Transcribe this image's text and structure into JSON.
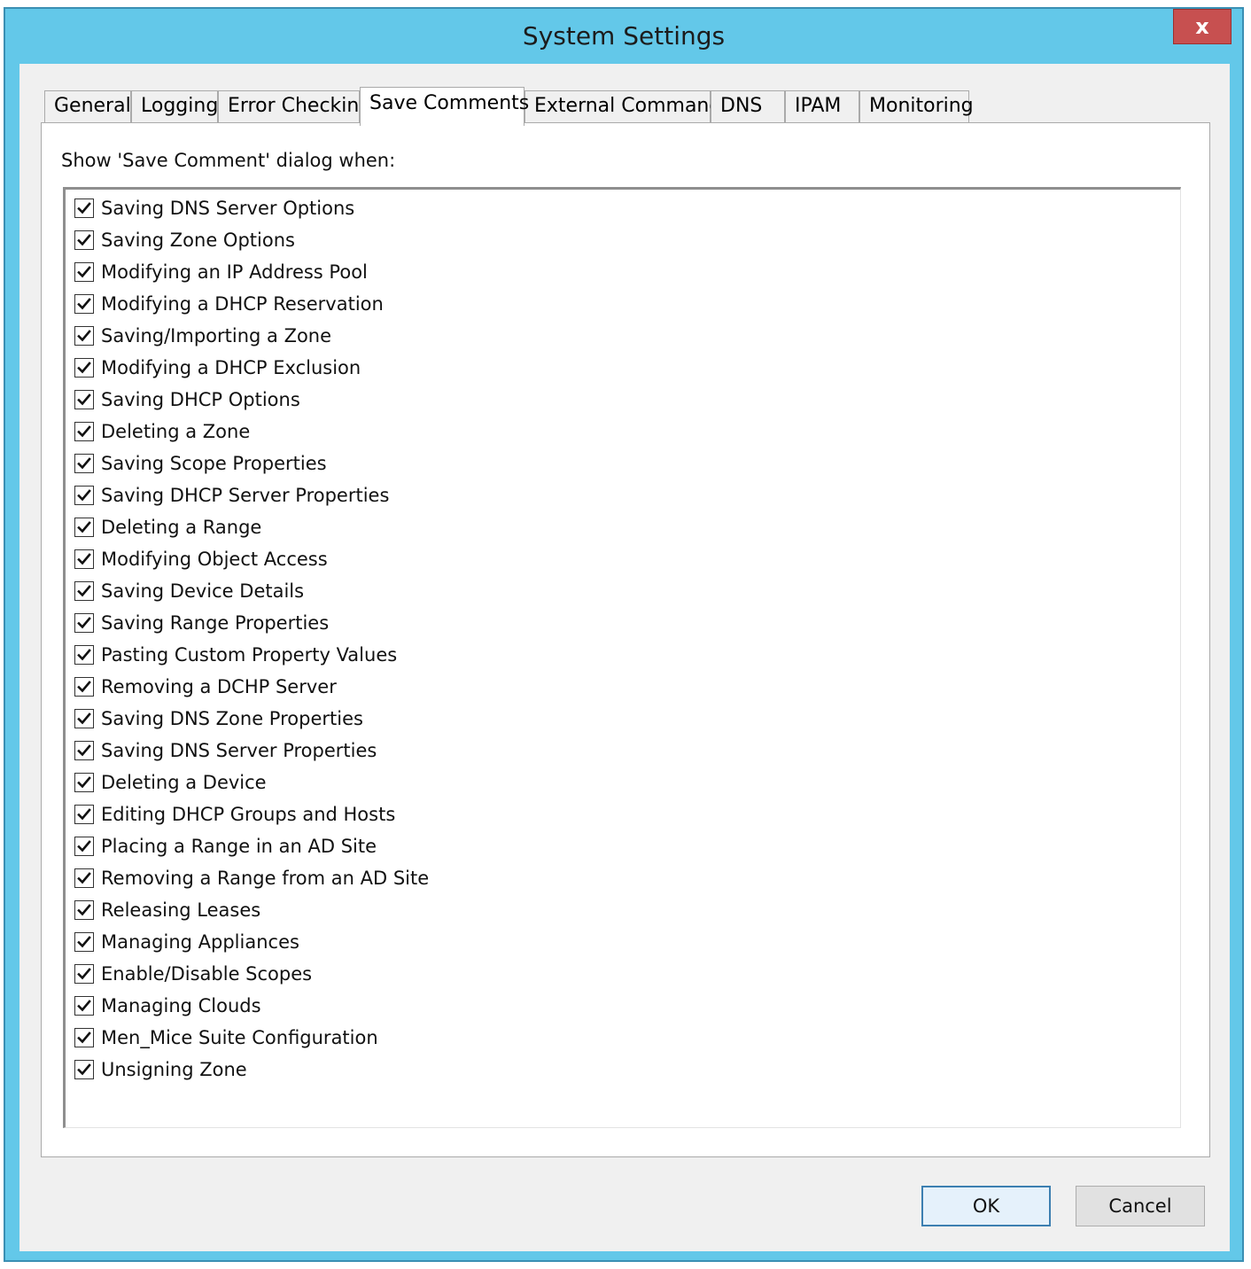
{
  "window": {
    "title": "System Settings",
    "close_label": "x"
  },
  "tabs": [
    {
      "label": "General"
    },
    {
      "label": "Logging"
    },
    {
      "label": "Error Checking"
    },
    {
      "label": "Save Comments",
      "active": true
    },
    {
      "label": "External Commands"
    },
    {
      "label": "DNS"
    },
    {
      "label": "IPAM"
    },
    {
      "label": "Monitoring"
    }
  ],
  "panel": {
    "label": "Show 'Save Comment' dialog when:",
    "options": [
      {
        "label": "Saving DNS Server Options",
        "checked": true
      },
      {
        "label": "Saving Zone Options",
        "checked": true
      },
      {
        "label": "Modifying an IP Address Pool",
        "checked": true
      },
      {
        "label": "Modifying a DHCP Reservation",
        "checked": true
      },
      {
        "label": "Saving/Importing a Zone",
        "checked": true
      },
      {
        "label": "Modifying a DHCP Exclusion",
        "checked": true
      },
      {
        "label": "Saving DHCP Options",
        "checked": true
      },
      {
        "label": "Deleting a Zone",
        "checked": true
      },
      {
        "label": "Saving Scope Properties",
        "checked": true
      },
      {
        "label": "Saving DHCP Server Properties",
        "checked": true
      },
      {
        "label": "Deleting a Range",
        "checked": true
      },
      {
        "label": "Modifying Object Access",
        "checked": true
      },
      {
        "label": "Saving Device Details",
        "checked": true
      },
      {
        "label": "Saving Range Properties",
        "checked": true
      },
      {
        "label": "Pasting Custom Property Values",
        "checked": true
      },
      {
        "label": "Removing a DCHP Server",
        "checked": true
      },
      {
        "label": "Saving DNS Zone Properties",
        "checked": true
      },
      {
        "label": "Saving DNS Server Properties",
        "checked": true
      },
      {
        "label": "Deleting a Device",
        "checked": true
      },
      {
        "label": "Editing DHCP Groups and Hosts",
        "checked": true
      },
      {
        "label": "Placing a Range in an AD Site",
        "checked": true
      },
      {
        "label": "Removing a Range from an AD Site",
        "checked": true
      },
      {
        "label": "Releasing Leases",
        "checked": true
      },
      {
        "label": "Managing Appliances",
        "checked": true
      },
      {
        "label": "Enable/Disable Scopes",
        "checked": true
      },
      {
        "label": "Managing Clouds",
        "checked": true
      },
      {
        "label": "Men_Mice Suite Configuration",
        "checked": true
      },
      {
        "label": "Unsigning Zone",
        "checked": true
      }
    ]
  },
  "buttons": {
    "ok_label": "OK",
    "cancel_label": "Cancel"
  },
  "colors": {
    "titlebar": "#63c8e9",
    "close": "#c75050",
    "client": "#f0f0f0"
  }
}
